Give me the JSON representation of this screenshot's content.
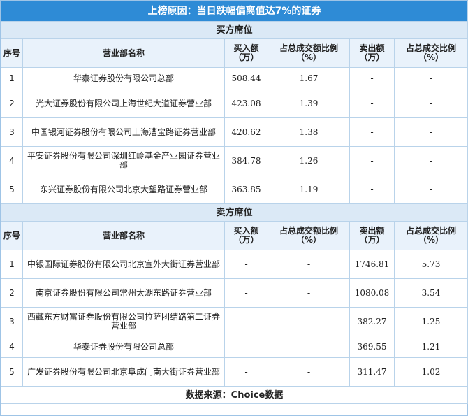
{
  "title": "上榜原因：当日跌幅偏离值达7%的证券",
  "buy_section": {
    "label": "买方席位",
    "headers": [
      "序号",
      "营业部名称",
      "买入额（万）",
      "占总成交额比例（%）",
      "卖出额（万）",
      "占总成交比例（%）"
    ],
    "rows": [
      {
        "no": "1",
        "name": "华泰证券股份有限公司总部",
        "buy": "508.44",
        "buy_pct": "1.67",
        "sell": "-",
        "sell_pct": "-"
      },
      {
        "no": "2",
        "name": "光大证券股份有限公司上海世纪大道证券营业部",
        "buy": "423.08",
        "buy_pct": "1.39",
        "sell": "-",
        "sell_pct": "-"
      },
      {
        "no": "3",
        "name": "中国银河证券股份有限公司上海漕宝路证券营业部",
        "buy": "420.62",
        "buy_pct": "1.38",
        "sell": "-",
        "sell_pct": "-"
      },
      {
        "no": "4",
        "name": "平安证券股份有限公司深圳红岭基金产业园证券营业部",
        "buy": "384.78",
        "buy_pct": "1.26",
        "sell": "-",
        "sell_pct": "-"
      },
      {
        "no": "5",
        "name": "东兴证券股份有限公司北京大望路证券营业部",
        "buy": "363.85",
        "buy_pct": "1.19",
        "sell": "-",
        "sell_pct": "-"
      }
    ]
  },
  "sell_section": {
    "label": "卖方席位",
    "headers": [
      "序号",
      "营业部名称",
      "买入额（万）",
      "占总成交额比例（%）",
      "卖出额（万）",
      "占总成交比例（%）"
    ],
    "rows": [
      {
        "no": "1",
        "name": "中银国际证券股份有限公司北京宣外大街证券营业部",
        "buy": "-",
        "buy_pct": "-",
        "sell": "1746.81",
        "sell_pct": "5.73"
      },
      {
        "no": "2",
        "name": "南京证券股份有限公司常州太湖东路证券营业部",
        "buy": "-",
        "buy_pct": "-",
        "sell": "1080.08",
        "sell_pct": "3.54"
      },
      {
        "no": "3",
        "name": "西藏东方财富证券股份有限公司拉萨团结路第二证券营业部",
        "buy": "-",
        "buy_pct": "-",
        "sell": "382.27",
        "sell_pct": "1.25"
      },
      {
        "no": "4",
        "name": "华泰证券股份有限公司总部",
        "buy": "-",
        "buy_pct": "-",
        "sell": "369.55",
        "sell_pct": "1.21"
      },
      {
        "no": "5",
        "name": "广发证券股份有限公司北京阜成门南大街证券营业部",
        "buy": "-",
        "buy_pct": "-",
        "sell": "311.47",
        "sell_pct": "1.02"
      }
    ]
  },
  "footer": "数据来源：Choice数据"
}
